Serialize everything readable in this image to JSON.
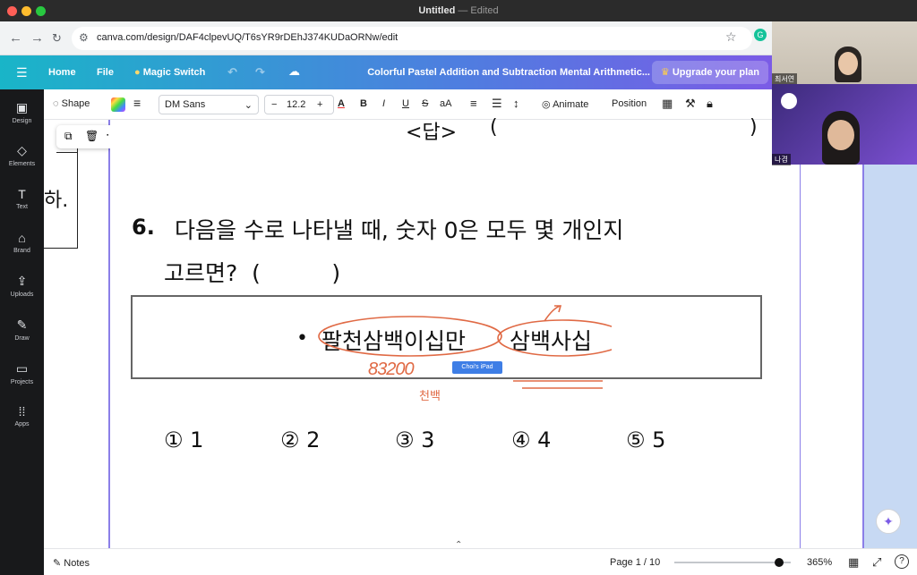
{
  "window": {
    "title": "Untitled",
    "subtitle": "— Edited"
  },
  "browser": {
    "url": "canva.com/design/DAF4clpevUQ/T6sYR9rDEhJ374KUDaORNw/edit"
  },
  "header": {
    "home": "Home",
    "file": "File",
    "magic_switch": "Magic Switch",
    "design_title": "Colorful Pastel Addition and Subtraction Mental Arithmetic...",
    "upgrade": "Upgrade your plan"
  },
  "sidebar": {
    "items": [
      {
        "label": "Design",
        "icon": "design-icon"
      },
      {
        "label": "Elements",
        "icon": "elements-icon"
      },
      {
        "label": "Text",
        "icon": "text-icon"
      },
      {
        "label": "Brand",
        "icon": "brand-icon"
      },
      {
        "label": "Uploads",
        "icon": "uploads-icon"
      },
      {
        "label": "Draw",
        "icon": "draw-icon"
      },
      {
        "label": "Projects",
        "icon": "projects-icon"
      },
      {
        "label": "Apps",
        "icon": "apps-icon"
      }
    ]
  },
  "toolbar": {
    "shape": "Shape",
    "font": "DM Sans",
    "font_size": "12.2",
    "animate": "Animate",
    "position": "Position",
    "minus": "−",
    "plus": "+"
  },
  "content": {
    "answer_label": "<답>",
    "answer_paren_open": "(",
    "answer_paren_close": ")",
    "left_fragment": "하.",
    "q_number": "6.",
    "q_line1": "다음을 수로 나타낼 때, 숫자 0은 모두 몇 개인지",
    "q_line2": "고르면?  (          )",
    "box_bullet": "•",
    "box_text1": "팔천삼백이십만",
    "box_text2": "삼백사십",
    "handwriting": "83200",
    "handwriting2": "천백",
    "ipad_tag": "Choi's iPad",
    "choices": [
      {
        "mark": "①",
        "value": "1"
      },
      {
        "mark": "②",
        "value": "2"
      },
      {
        "mark": "③",
        "value": "3"
      },
      {
        "mark": "④",
        "value": "4"
      },
      {
        "mark": "⑤",
        "value": "5"
      }
    ]
  },
  "bottom": {
    "notes": "Notes",
    "page": "Page 1 / 10",
    "zoom": "365%",
    "zoom_level": 0.9
  },
  "video": {
    "participant1": "최서연",
    "participant2": "나겸"
  },
  "colors": {
    "accent": "#8b7fe8",
    "annotation": "#e06a45"
  }
}
